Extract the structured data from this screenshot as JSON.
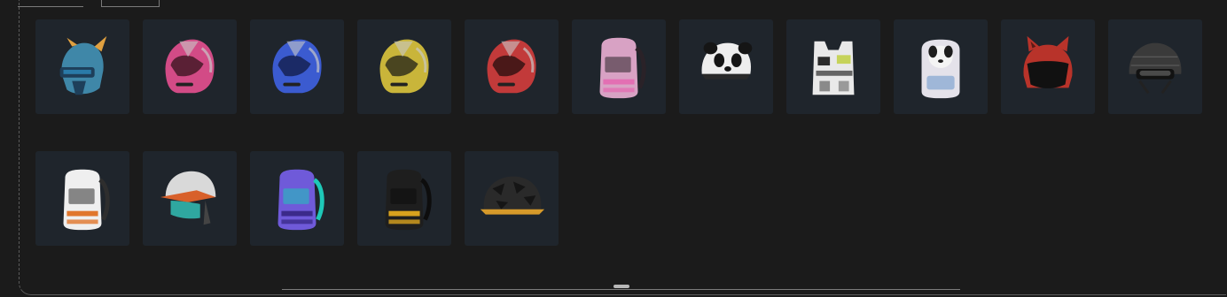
{
  "inventory": {
    "rows": [
      [
        {
          "name": "helmet-item-blue-horned",
          "icon": "horned-helmet-icon",
          "kind": "horned-helmet",
          "colors": [
            "#3f87a8",
            "#1e3f5a",
            "#e0a040"
          ]
        },
        {
          "name": "helmet-item-pink-visor",
          "icon": "motorcycle-helmet-icon",
          "kind": "motor-helmet",
          "colors": [
            "#d24b86",
            "#5a2035",
            "#c8c8c8"
          ]
        },
        {
          "name": "helmet-item-blue-visor",
          "icon": "motorcycle-helmet-icon",
          "kind": "motor-helmet",
          "colors": [
            "#3b5bd0",
            "#1b2a66",
            "#c8c8c8"
          ]
        },
        {
          "name": "helmet-item-yellow-visor",
          "icon": "motorcycle-helmet-icon",
          "kind": "motor-helmet",
          "colors": [
            "#c9b53a",
            "#4a4520",
            "#c8c8c8"
          ]
        },
        {
          "name": "helmet-item-red-visor",
          "icon": "motorcycle-helmet-icon",
          "kind": "motor-helmet",
          "colors": [
            "#c23a3a",
            "#4a1818",
            "#c8c8c8"
          ]
        },
        {
          "name": "backpack-item-pink-leopard",
          "icon": "backpack-icon",
          "kind": "backpack",
          "colors": [
            "#d8a2c4",
            "#2a2228",
            "#e36fb3"
          ]
        },
        {
          "name": "helmet-item-panda",
          "icon": "panda-helmet-icon",
          "kind": "panda-helmet",
          "colors": [
            "#eeeeee",
            "#151515",
            "#d8d8d8"
          ]
        },
        {
          "name": "vest-item-camo",
          "icon": "armor-vest-icon",
          "kind": "vest",
          "colors": [
            "#e9e9e9",
            "#2b2b2b",
            "#c6d35a"
          ]
        },
        {
          "name": "backpack-item-dog",
          "icon": "dog-backpack-icon",
          "kind": "dog-backpack",
          "colors": [
            "#e4e2ea",
            "#1d1d1d",
            "#9fb7d8"
          ]
        },
        {
          "name": "helmet-item-cat-ears",
          "icon": "cat-helmet-icon",
          "kind": "cat-helmet",
          "colors": [
            "#b8332a",
            "#111111",
            "#5a1a16"
          ]
        },
        {
          "name": "helmet-item-carbon",
          "icon": "tactical-helmet-icon",
          "kind": "tactical-helmet",
          "colors": [
            "#3a3a3a",
            "#121212",
            "#8c8c8c"
          ]
        }
      ],
      [
        {
          "name": "backpack-item-white-orange",
          "icon": "backpack-icon",
          "kind": "backpack",
          "colors": [
            "#efefef",
            "#2e2e2e",
            "#e0762c"
          ]
        },
        {
          "name": "helmet-item-orange-visor",
          "icon": "open-helmet-icon",
          "kind": "open-helmet",
          "colors": [
            "#d9d9d9",
            "#d8602a",
            "#2fa7a0"
          ]
        },
        {
          "name": "backpack-item-neon-camo",
          "icon": "backpack-icon",
          "kind": "backpack",
          "colors": [
            "#6f5ad9",
            "#1ec8b8",
            "#3b2a8a"
          ]
        },
        {
          "name": "backpack-item-black-gold",
          "icon": "backpack-icon",
          "kind": "backpack",
          "colors": [
            "#1e1e1e",
            "#0d0d0d",
            "#d8a21e"
          ]
        },
        {
          "name": "helmet-item-yellow-camo",
          "icon": "army-helmet-icon",
          "kind": "army-helmet",
          "colors": [
            "#2a2a2a",
            "#d69a2a",
            "#151515"
          ]
        }
      ]
    ]
  }
}
